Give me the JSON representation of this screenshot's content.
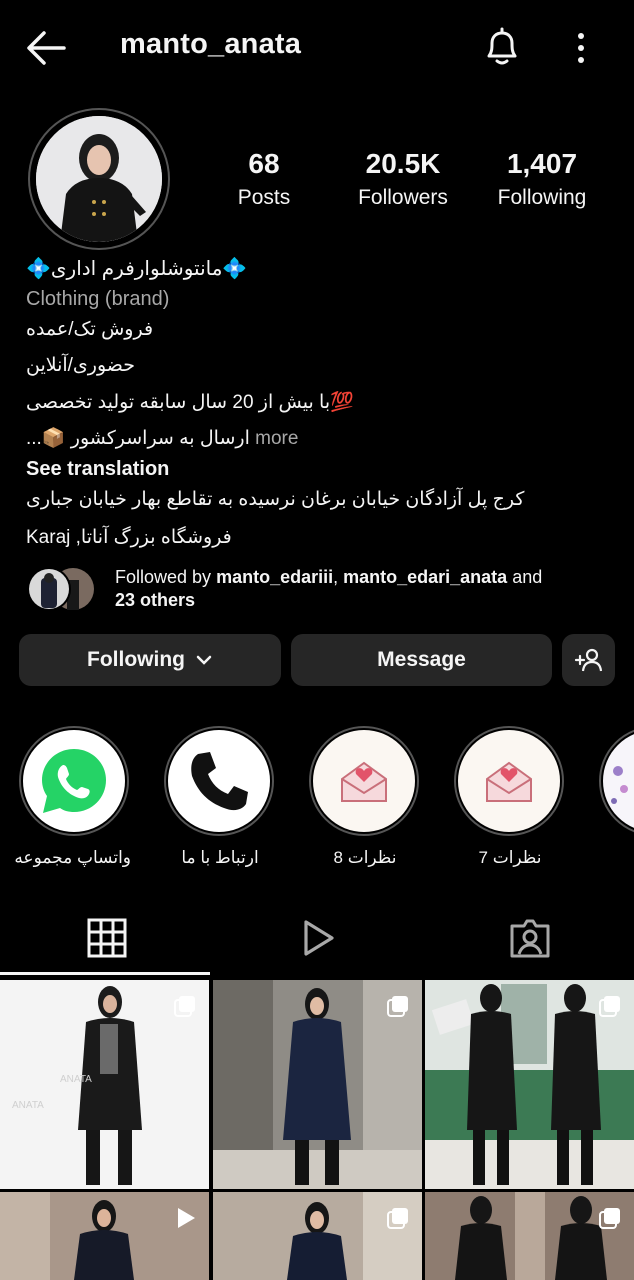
{
  "header": {
    "username": "manto_anata"
  },
  "stats": [
    {
      "value": "68",
      "label": "Posts"
    },
    {
      "value": "20.5K",
      "label": "Followers"
    },
    {
      "value": "1,407",
      "label": "Following"
    }
  ],
  "bio": {
    "name": "💠مانتوشلوارفرم اداری💠",
    "category": "Clothing (brand)",
    "line1": "فروش تک/عمده",
    "line2": "حضوری/آنلاین",
    "line3": "💯با بیش از 20 سال سابقه تولید تخصصی",
    "line4": "ارسال به سراسرکشور 📦...",
    "more": " more",
    "see_translation": "See translation",
    "address1": "کرج پل آزادگان خیابان برغان نرسیده به تقاطع بهار خیابان جباری",
    "address2": "فروشگاه بزرگ آناتا, Karaj"
  },
  "followed_by": {
    "prefix": "Followed by ",
    "user1": "manto_edariii",
    "sep": ", ",
    "user2": "manto_edari_anata",
    "and": " and",
    "others": "23 others"
  },
  "buttons": {
    "following": "Following",
    "message": "Message"
  },
  "highlights": [
    {
      "label": "واتساپ مجموعه",
      "icon": "whatsapp-icon"
    },
    {
      "label": "ارتباط با ما",
      "icon": "phone-icon"
    },
    {
      "label": "نظرات 8",
      "icon": "envelope-heart-icon"
    },
    {
      "label": "نظرات 7",
      "icon": "envelope-heart-icon"
    },
    {
      "label": "",
      "icon": "floral-icon"
    }
  ],
  "tabs": [
    "grid-icon",
    "reels-icon",
    "tagged-icon"
  ],
  "grid_watermark": "ANATA",
  "colors": {
    "background": "#000000",
    "button": "#262626",
    "text": "#f5f5f5",
    "secondary": "#a8a8a8"
  }
}
